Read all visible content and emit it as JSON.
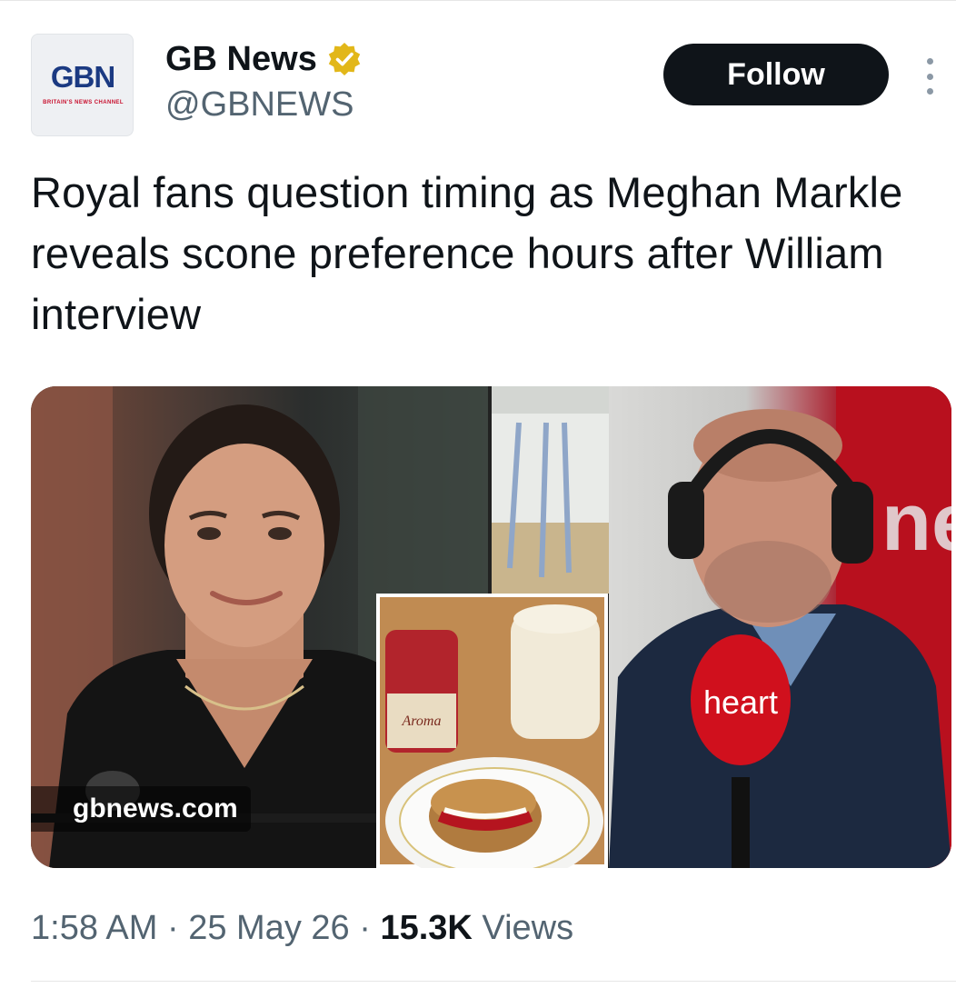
{
  "account": {
    "display_name": "GB News",
    "handle": "@GBNEWS",
    "verified": true,
    "avatar": {
      "logo_text": "GBN",
      "tagline": "BRITAIN'S NEWS CHANNEL"
    }
  },
  "actions": {
    "follow_label": "Follow",
    "more_icon": "more-vertical-icon"
  },
  "tweet": {
    "text": "Royal fans question timing as Meghan Markle reveals scone preference hours after William interview",
    "media": {
      "watermark": "gbnews.com",
      "mic_brand": "heart",
      "jar_label": "Aroma",
      "background_sign": "ne"
    }
  },
  "footer": {
    "time": "1:58 AM",
    "separator": "·",
    "date": "25 May 26",
    "views_count": "15.3K",
    "views_label": "Views"
  },
  "colors": {
    "text": "#0f1419",
    "secondary": "#536471",
    "verified_gold": "#e2b719",
    "button_bg": "#0f1419",
    "heart_red": "#d0101d"
  }
}
